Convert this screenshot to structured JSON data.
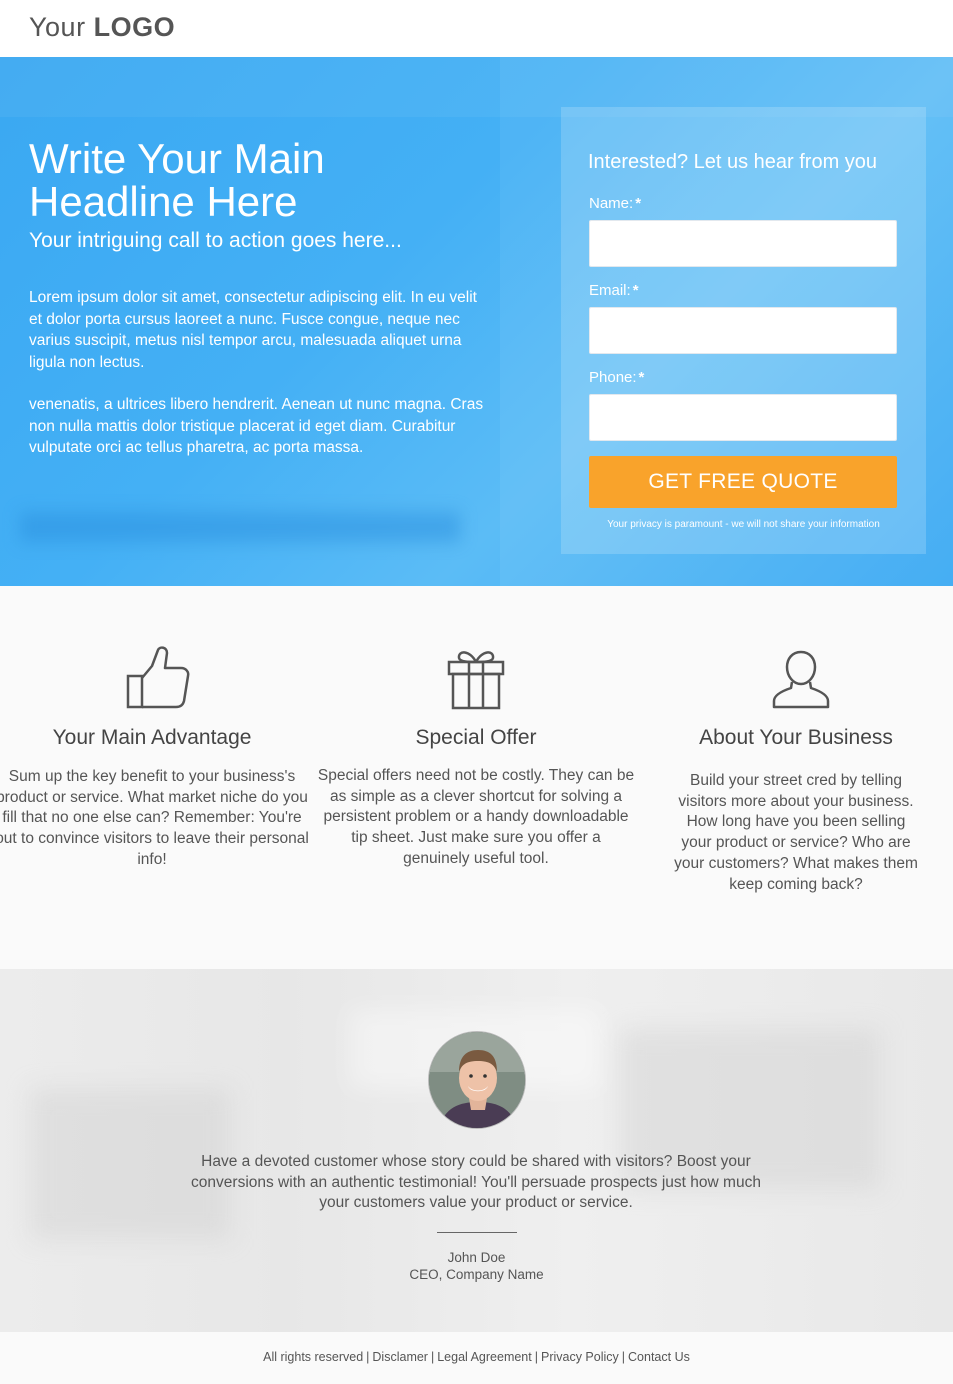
{
  "header": {
    "logo_light": "Your",
    "logo_bold": "LOGO"
  },
  "hero": {
    "headline_line1": "Write Your Main",
    "headline_line2": "Headline Here",
    "subhead": "Your intriguing call to action goes here...",
    "paragraph1": "Lorem ipsum dolor sit amet, consectetur adipiscing elit. In eu velit et dolor porta cursus laoreet a nunc. Fusce congue, neque nec varius suscipit, metus nisl tempor arcu, malesuada aliquet urna ligula non lectus.",
    "paragraph2": "venenatis, a ultrices libero hendrerit. Aenean ut nunc magna. Cras non nulla mattis dolor tristique placerat id eget diam. Curabitur vulputate orci ac tellus pharetra, ac porta massa."
  },
  "form": {
    "title": "Interested? Let us hear from you",
    "fields": [
      {
        "label": "Name:",
        "required_mark": "*",
        "value": ""
      },
      {
        "label": "Email:",
        "required_mark": "*",
        "value": ""
      },
      {
        "label": "Phone:",
        "required_mark": "*",
        "value": ""
      }
    ],
    "submit_label": "GET FREE QUOTE",
    "privacy_note": "Your privacy is paramount - we will not share your information"
  },
  "features": [
    {
      "icon": "thumbs-up-icon",
      "title": "Your Main Advantage",
      "text": "Sum up the key benefit to your business's product or service. What market niche do you fill that no one else can? Remember: You're out to convince visitors to leave their personal info!"
    },
    {
      "icon": "gift-icon",
      "title": "Special Offer",
      "text": "Special offers need not be costly. They can be as simple as a clever shortcut for solving a persistent problem or a handy downloadable tip sheet. Just make sure you offer a genuinely useful tool."
    },
    {
      "icon": "user-icon",
      "title": "About Your Business",
      "text": "Build your street cred by telling visitors more about your business. How long have you been selling your product or service? Who are your customers? What makes them keep coming back?"
    }
  ],
  "testimonial": {
    "quote": "Have a devoted customer whose story could be shared with visitors? Boost your conversions with an authentic testimonial! You'll persuade prospects just how much your customers value your product or service.",
    "author_name": "John Doe",
    "author_title": "CEO, Company Name"
  },
  "footer": {
    "links": [
      "All rights reserved",
      "Disclamer",
      "Legal Agreement",
      "Privacy Policy",
      "Contact Us"
    ]
  },
  "colors": {
    "hero_blue": "#44b0f5",
    "cta_orange": "#f9a32b"
  }
}
